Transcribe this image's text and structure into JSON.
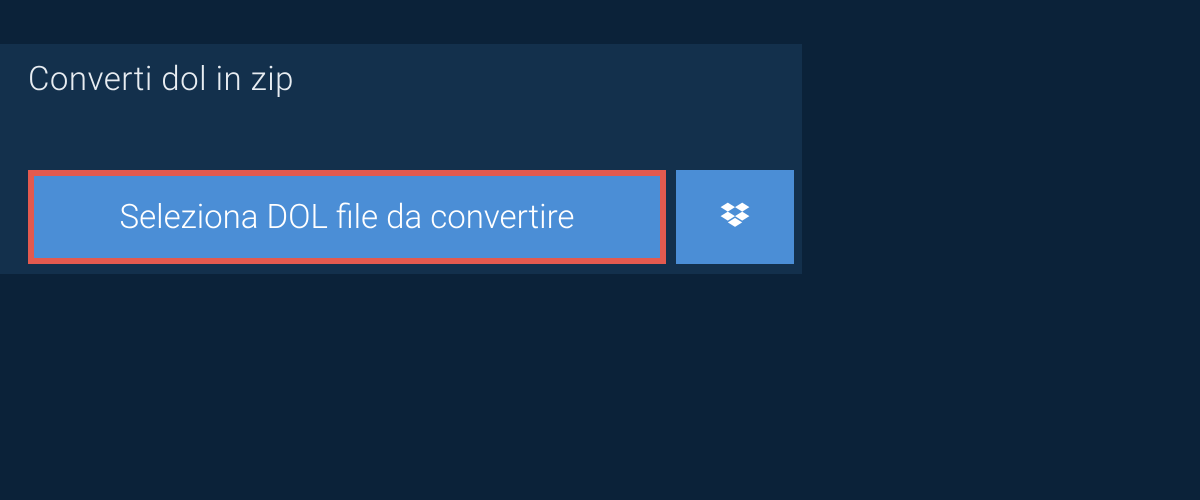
{
  "tab": {
    "label": "Converti dol in zip"
  },
  "buttons": {
    "select_file_label": "Seleziona DOL file da convertire"
  },
  "colors": {
    "background": "#0b2239",
    "panel": "#13304c",
    "button_bg": "#4b8ed6",
    "button_highlight_border": "#e35a4f",
    "text_light": "#e8edf2",
    "text_white": "#ffffff"
  }
}
